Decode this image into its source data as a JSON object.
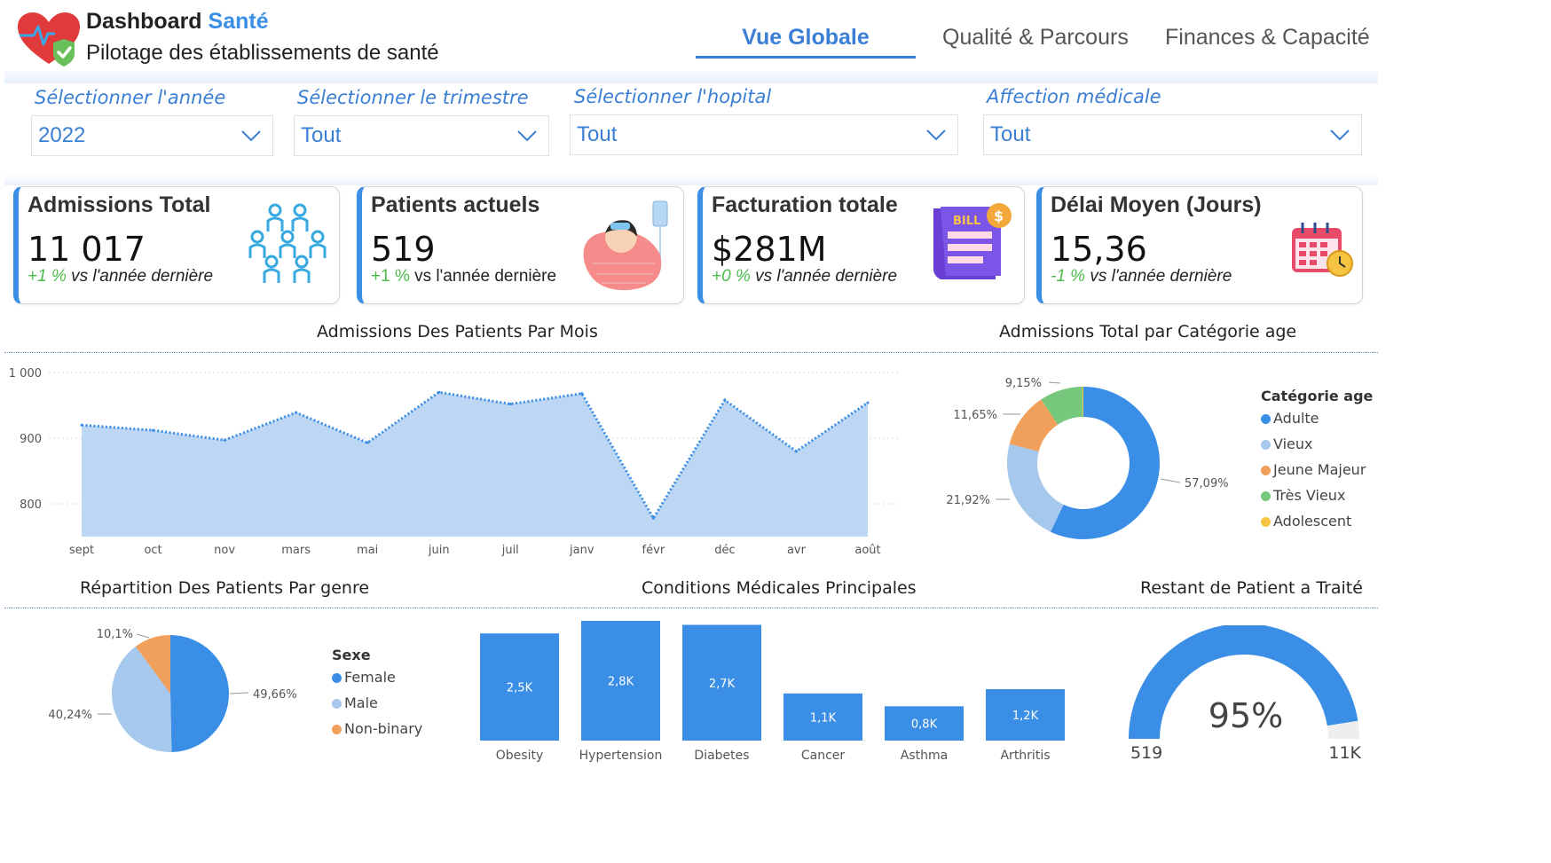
{
  "header": {
    "title_main": "Dashboard",
    "title_accent": "Santé",
    "subtitle": "Pilotage des établissements de santé",
    "logo_icon": "heart-shield-icon"
  },
  "tabs": [
    {
      "label": "Vue Globale",
      "active": true
    },
    {
      "label": "Qualité & Parcours",
      "active": false
    },
    {
      "label": "Finances & Capacité",
      "active": false
    }
  ],
  "filters": [
    {
      "label": "Sélectionner l'année",
      "value": "2022"
    },
    {
      "label": "Sélectionner le trimestre",
      "value": "Tout"
    },
    {
      "label": "Sélectionner l'hopital",
      "value": "Tout"
    },
    {
      "label": "Affection médicale",
      "value": "Tout"
    }
  ],
  "kpis": [
    {
      "title": "Admissions Total",
      "value": "11 017",
      "delta": "+1 %",
      "delta_text": "vs l'année dernière",
      "icon": "people-group-icon"
    },
    {
      "title": "Patients actuels",
      "value": "519",
      "delta": "+1 %",
      "delta_text": "vs l'année dernière",
      "icon": "sick-patient-icon"
    },
    {
      "title": "Facturation totale",
      "value": "$281M",
      "delta": "+0 %",
      "delta_text": "vs l'année dernière",
      "icon": "bill-icon"
    },
    {
      "title": "Délai Moyen (Jours)",
      "value": "15,36",
      "delta": "-1 %",
      "delta_text": "vs l'année dernière",
      "icon": "calendar-clock-icon"
    }
  ],
  "colors": {
    "accent": "#3a8ee6",
    "area_fill": "#bcd6f3",
    "area_line": "#3a8ee6",
    "delta_green": "#4cbb4c",
    "adulte": "#3a8ee6",
    "vieux": "#a6c8ec",
    "jeune_majeur": "#f0a05a",
    "tres_vieux": "#77c77c",
    "adolescent": "#f5c542",
    "female": "#3a8ee6",
    "male": "#a6c8ec",
    "non_binary": "#f0a05a",
    "gauge_fill": "#3a8ee6",
    "gauge_track": "#eeeeee"
  },
  "sections": {
    "monthly_title": "Admissions Des Patients Par Mois",
    "age_title": "Admissions Total par Catégorie age",
    "gender_title": "Répartition Des Patients Par genre",
    "conditions_title": "Conditions Médicales Principales",
    "remaining_title": "Restant de Patient a Traité"
  },
  "chart_data": [
    {
      "id": "monthly",
      "type": "area",
      "categories": [
        "sept",
        "oct",
        "nov",
        "mars",
        "mai",
        "juin",
        "juil",
        "janv",
        "févr",
        "déc",
        "avr",
        "août"
      ],
      "values": [
        920,
        912,
        897,
        939,
        893,
        970,
        952,
        968,
        778,
        958,
        880,
        954
      ],
      "ylim": [
        750,
        1000
      ],
      "yticks": [
        800,
        900,
        1000
      ],
      "ytick_labels": [
        "800",
        "900",
        "1 000"
      ],
      "grid": true
    },
    {
      "id": "age",
      "type": "pie",
      "donut": true,
      "legend_title": "Catégorie age",
      "legend_position": "right",
      "labels": [
        "Adulte",
        "Vieux",
        "Jeune Majeur",
        "Très Vieux",
        "Adolescent"
      ],
      "values": [
        57.09,
        21.92,
        11.65,
        9.15,
        0.19
      ],
      "data_labels": [
        "57,09%",
        "21,92%",
        "11,65%",
        "9,15%",
        ""
      ],
      "colors": [
        "#3a8ee6",
        "#a6c8ec",
        "#f0a05a",
        "#77c77c",
        "#f5c542"
      ]
    },
    {
      "id": "gender",
      "type": "pie",
      "donut": false,
      "legend_title": "Sexe",
      "legend_position": "right",
      "labels": [
        "Female",
        "Male",
        "Non-binary"
      ],
      "values": [
        49.66,
        40.24,
        10.1
      ],
      "data_labels": [
        "49,66%",
        "40,24%",
        "10,1%"
      ],
      "colors": [
        "#3a8ee6",
        "#a6c8ec",
        "#f0a05a"
      ]
    },
    {
      "id": "conditions",
      "type": "bar",
      "categories": [
        "Obesity",
        "Hypertension",
        "Diabetes",
        "Cancer",
        "Asthma",
        "Arthritis"
      ],
      "values": [
        2.5,
        2.8,
        2.7,
        1.1,
        0.8,
        1.2
      ],
      "data_labels": [
        "2,5K",
        "2,8K",
        "2,7K",
        "1,1K",
        "0,8K",
        "1,2K"
      ],
      "ylim": [
        0,
        3.0
      ]
    },
    {
      "id": "gauge",
      "type": "gauge",
      "value_label": "95%",
      "fraction": 0.95,
      "min_label": "519",
      "max_label": "11K"
    }
  ]
}
